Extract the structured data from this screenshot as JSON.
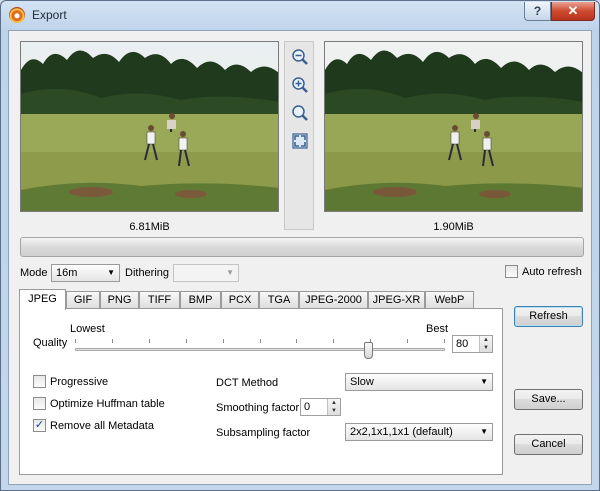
{
  "window": {
    "title": "Export",
    "help_label": "?",
    "close_label": "✕"
  },
  "preview": {
    "original_size": "6.81MiB",
    "export_size": "1.90MiB"
  },
  "zoom_tools": [
    "zoom-out-icon",
    "zoom-in-icon",
    "zoom-fit-icon",
    "fullscreen-icon"
  ],
  "progress": {
    "value": 0
  },
  "mode": {
    "label": "Mode",
    "value": "16m"
  },
  "dithering": {
    "label": "Dithering",
    "value": ""
  },
  "auto_refresh": {
    "label": "Auto refresh",
    "checked": false
  },
  "tabs": [
    "JPEG",
    "GIF",
    "PNG",
    "TIFF",
    "BMP",
    "PCX",
    "TGA",
    "JPEG-2000",
    "JPEG-XR",
    "WebP"
  ],
  "active_tab": "JPEG",
  "jpeg": {
    "quality_label": "Quality",
    "lowest_label": "Lowest",
    "best_label": "Best",
    "quality_value": "80",
    "quality_fraction": 0.8,
    "progressive_label": "Progressive",
    "progressive_checked": false,
    "optimize_label": "Optimize Huffman table",
    "optimize_checked": false,
    "remove_metadata_label": "Remove all Metadata",
    "remove_metadata_checked": true,
    "dct_label": "DCT Method",
    "dct_value": "Slow",
    "smoothing_label": "Smoothing factor",
    "smoothing_value": "0",
    "subsampling_label": "Subsampling factor",
    "subsampling_value": "2x2,1x1,1x1 (default)"
  },
  "buttons": {
    "refresh": "Refresh",
    "save": "Save...",
    "cancel": "Cancel"
  },
  "colors": {
    "accent": "#3c7fb1",
    "close": "#c9452a",
    "checkmark": "#1c3b8a"
  }
}
